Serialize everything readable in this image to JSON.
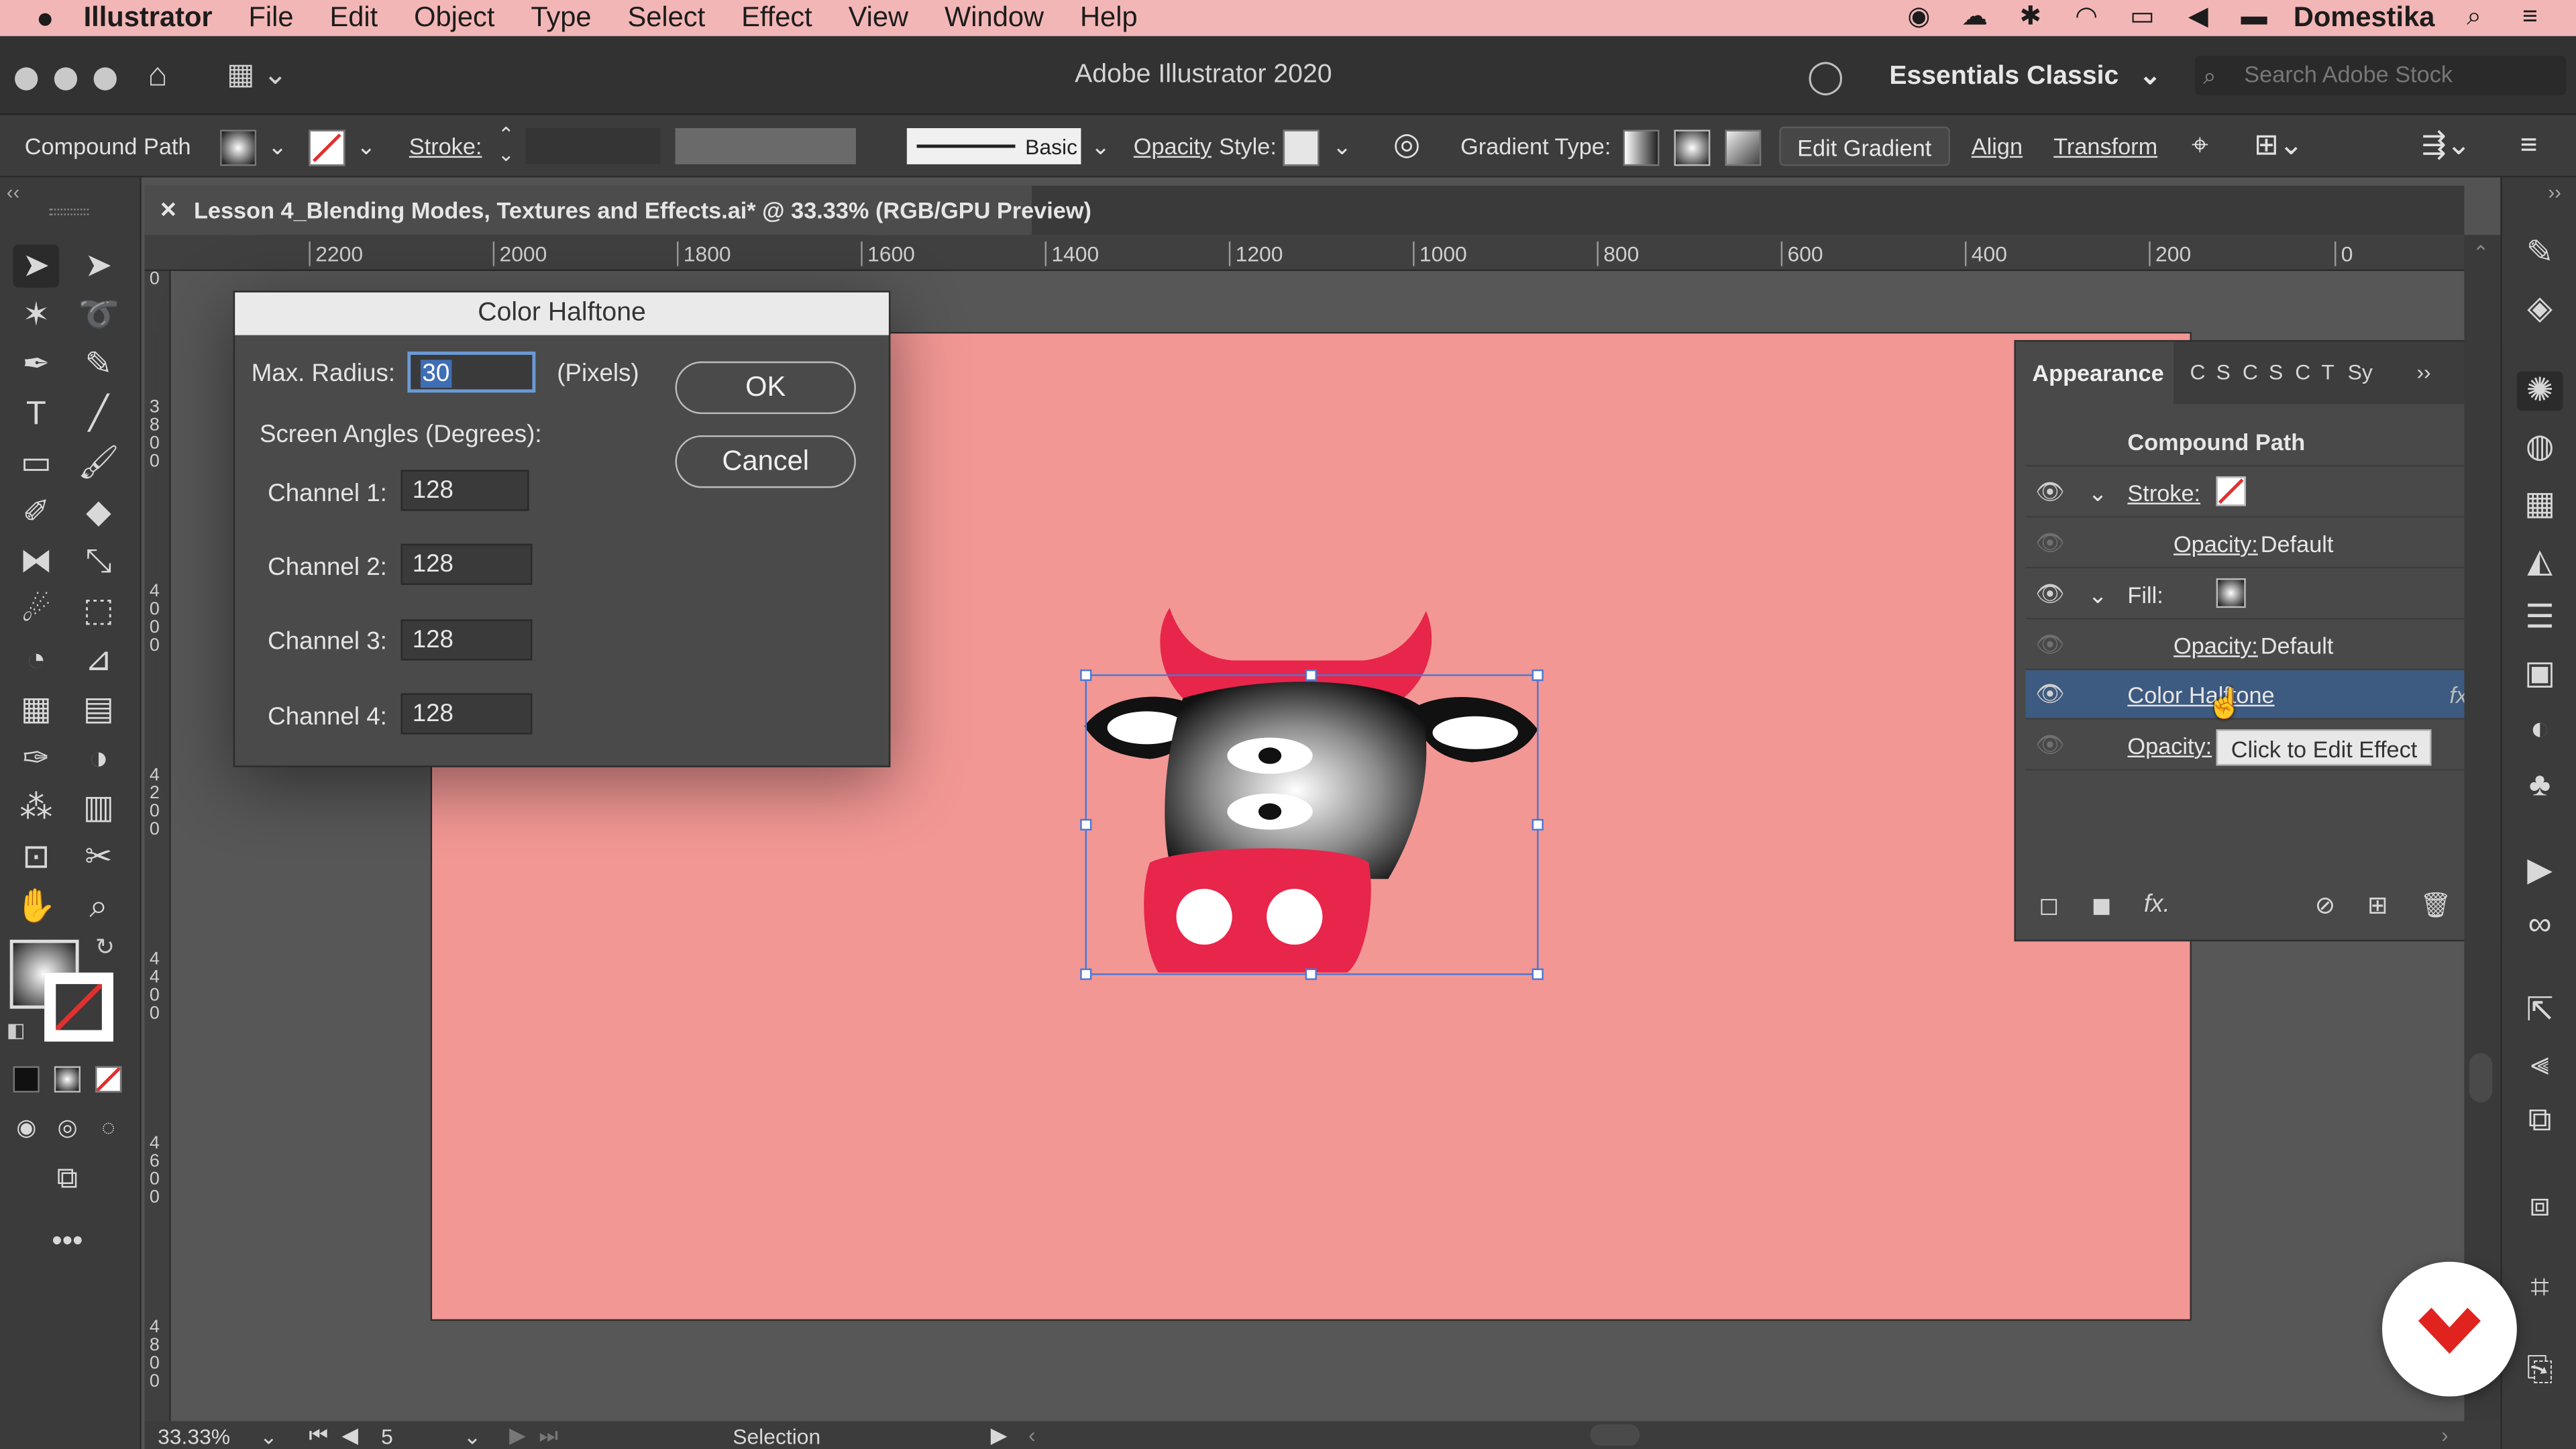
{
  "menubar": {
    "app_name": "Illustrator",
    "items": [
      "File",
      "Edit",
      "Object",
      "Type",
      "Select",
      "Effect",
      "View",
      "Window",
      "Help"
    ],
    "account": "Domestika"
  },
  "appbar": {
    "title": "Adobe Illustrator 2020",
    "workspace": "Essentials Classic",
    "search_placeholder": "Search Adobe Stock"
  },
  "controlbar": {
    "selection_type": "Compound Path",
    "stroke_label": "Stroke:",
    "brush_label": "Basic",
    "opacity_label": "Opacity",
    "style_label": "Style:",
    "gradient_type_label": "Gradient Type:",
    "edit_gradient_label": "Edit Gradient",
    "align_label": "Align",
    "transform_label": "Transform"
  },
  "document": {
    "tab_title": "Lesson 4_Blending Modes, Textures and Effects.ai* @ 33.33% (RGB/GPU Preview)",
    "close_glyph": "✕"
  },
  "ruler": {
    "h_ticks": [
      "2200",
      "2000",
      "1800",
      "1600",
      "1400",
      "1200",
      "1000",
      "800",
      "600",
      "400",
      "200",
      "0"
    ],
    "v_ticks": [
      "0",
      "3\n8\n0\n0",
      "4\n0\n0\n0",
      "4\n2\n0\n0",
      "4\n4\n0\n0",
      "4\n6\n0\n0",
      "4\n8\n0\n0"
    ]
  },
  "dialog": {
    "title": "Color Halftone",
    "max_radius_label": "Max. Radius:",
    "max_radius_value": "30",
    "pixels_label": "(Pixels)",
    "screen_angles_label": "Screen Angles (Degrees):",
    "channels": [
      {
        "label": "Channel 1:",
        "value": "128"
      },
      {
        "label": "Channel 2:",
        "value": "128"
      },
      {
        "label": "Channel 3:",
        "value": "128"
      },
      {
        "label": "Channel 4:",
        "value": "128"
      }
    ],
    "ok_label": "OK",
    "cancel_label": "Cancel"
  },
  "appearance": {
    "tab_label": "Appearance",
    "other_tabs": [
      "C",
      "S",
      "C",
      "S",
      "C",
      "T",
      "Sy"
    ],
    "object_type": "Compound Path",
    "stroke_label": "Stroke:",
    "stroke_opacity_label": "Opacity:",
    "stroke_opacity_value": "Default",
    "fill_label": "Fill:",
    "fill_opacity_label": "Opacity:",
    "fill_opacity_value": "Default",
    "effect_label": "Color Halftone",
    "effect_icon": "fx",
    "last_opacity_label": "Opacity:",
    "tooltip": "Click to Edit Effect"
  },
  "statusbar": {
    "zoom": "33.33%",
    "artboard_number": "5",
    "tool_status": "Selection"
  },
  "colors": {
    "artboard": "#f29794",
    "menubar": "#f3b6b6",
    "accent_red": "#e8254b",
    "selection_blue": "#4a78d6",
    "appearance_selected_row": "#3d5a80"
  },
  "icons": {
    "apple": "apple-icon",
    "home": "home-icon",
    "search": "search-icon",
    "eye": "eye-icon",
    "domestika": "domestika-logo"
  }
}
